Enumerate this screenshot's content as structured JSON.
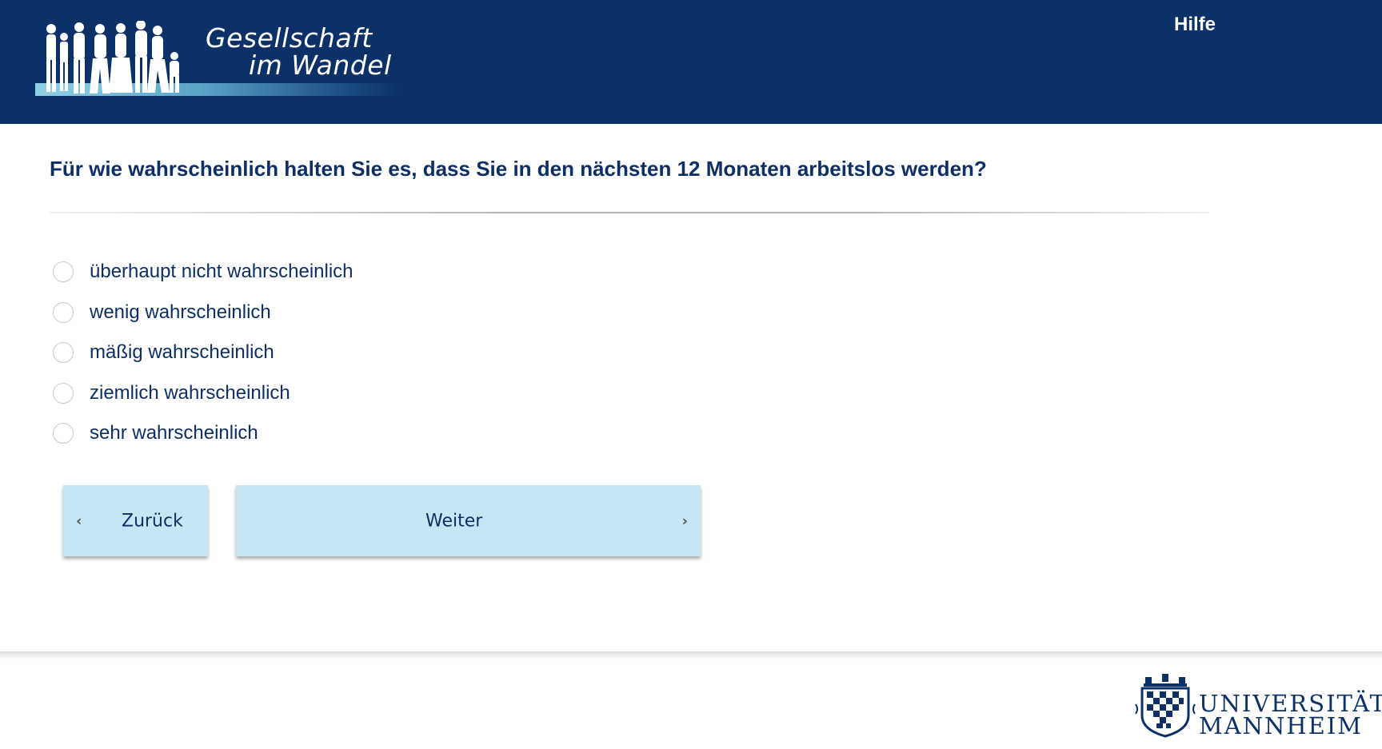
{
  "header": {
    "logo_line1": "Gesellschaft",
    "logo_line2": "im Wandel",
    "help_label": "Hilfe"
  },
  "question": {
    "text": "Für wie wahrscheinlich halten Sie es, dass Sie in den nächsten 12 Monaten arbeitslos werden?",
    "options": [
      {
        "label": "überhaupt nicht wahrscheinlich",
        "selected": false
      },
      {
        "label": "wenig wahrscheinlich",
        "selected": false
      },
      {
        "label": "mäßig wahrscheinlich",
        "selected": false
      },
      {
        "label": "ziemlich wahrscheinlich",
        "selected": false
      },
      {
        "label": "sehr wahrscheinlich",
        "selected": false
      }
    ]
  },
  "navigation": {
    "back_label": "Zurück",
    "next_label": "Weiter"
  },
  "footer": {
    "university_line1": "UNIVERSITÄT",
    "university_line2": "MANNHEIM"
  },
  "colors": {
    "header_bg": "#0b3166",
    "text_primary": "#0d2f63",
    "button_bg": "#c5e7f4"
  },
  "icons": {
    "back": "chevron-left-icon",
    "next": "chevron-right-icon",
    "logo": "people-silhouette-logo",
    "crest": "university-crest-icon"
  }
}
